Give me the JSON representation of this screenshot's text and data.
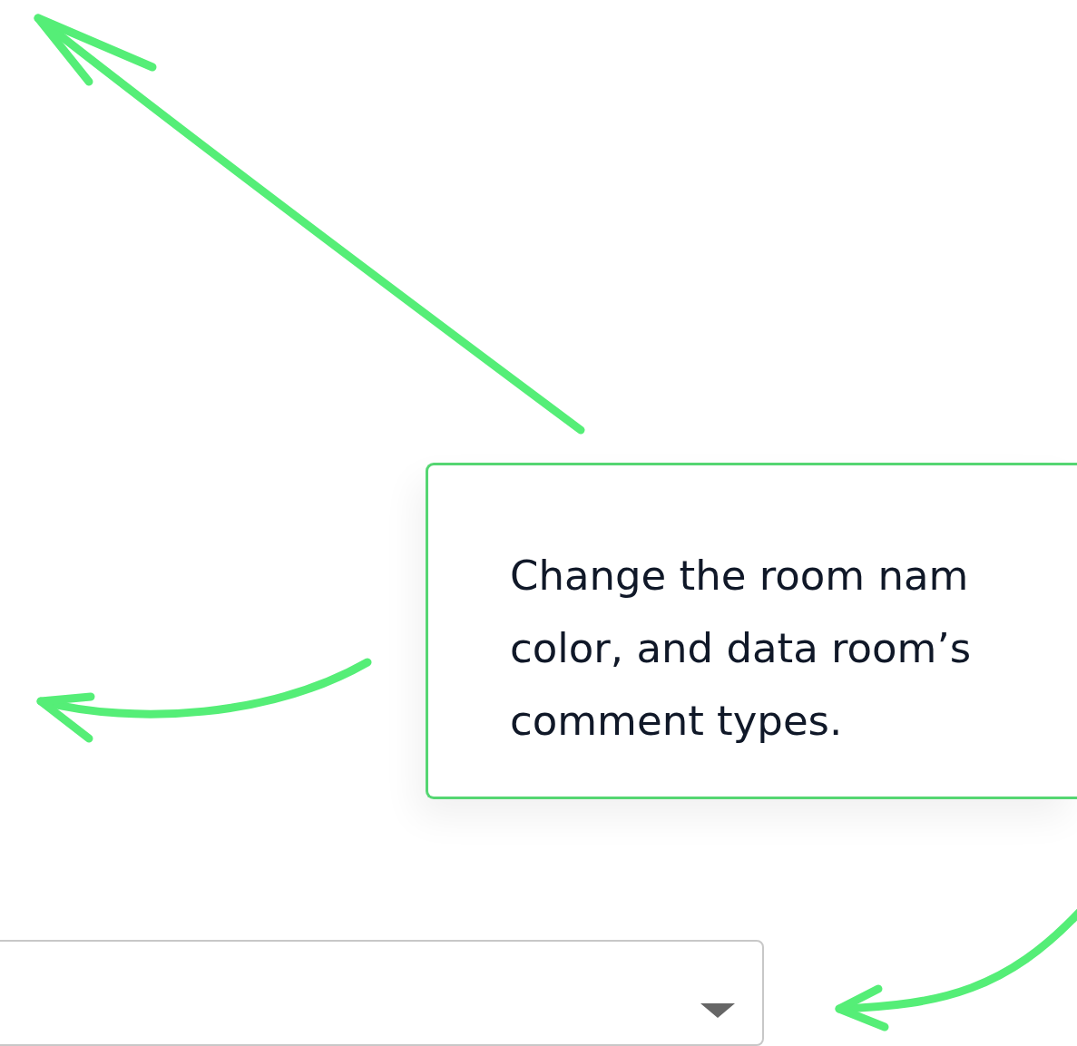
{
  "callout": {
    "lines": [
      "Change the room nam",
      "color, and data room’s",
      "comment types."
    ]
  }
}
